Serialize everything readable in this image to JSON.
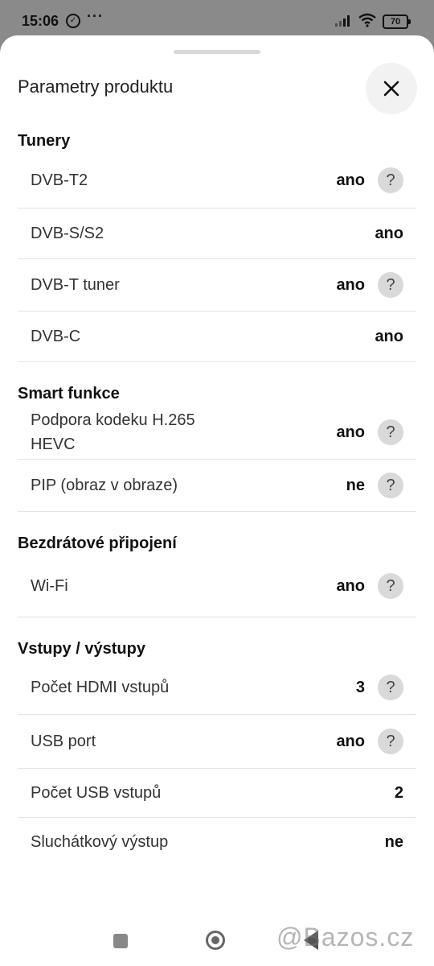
{
  "status_bar": {
    "time": "15:06",
    "dots": "···",
    "battery": "70"
  },
  "sheet": {
    "title": "Parametry produktu",
    "close_icon": "close-icon"
  },
  "sections": [
    {
      "title": "Tunery",
      "rows": [
        {
          "label": "DVB-T2",
          "value": "ano",
          "help": true
        },
        {
          "label": "DVB-S/S2",
          "value": "ano",
          "help": false
        },
        {
          "label": "DVB-T tuner",
          "value": "ano",
          "help": true
        },
        {
          "label": "DVB-C",
          "value": "ano",
          "help": false
        }
      ]
    },
    {
      "title": "Smart funkce",
      "rows": [
        {
          "label": "Podpora kodeku H.265 HEVC",
          "value": "ano",
          "help": true
        },
        {
          "label": "PIP (obraz v obraze)",
          "value": "ne",
          "help": true
        }
      ]
    },
    {
      "title": "Bezdrátové připojení",
      "rows": [
        {
          "label": "Wi-Fi",
          "value": "ano",
          "help": true
        }
      ]
    },
    {
      "title": "Vstupy / výstupy",
      "rows": [
        {
          "label": "Počet HDMI vstupů",
          "value": "3",
          "help": true
        },
        {
          "label": "USB port",
          "value": "ano",
          "help": true
        },
        {
          "label": "Počet USB vstupů",
          "value": "2",
          "help": false
        },
        {
          "label": "Sluchátkový výstup",
          "value": "ne",
          "help": false
        }
      ]
    }
  ],
  "help_symbol": "?",
  "watermark": "@Bazos.cz"
}
